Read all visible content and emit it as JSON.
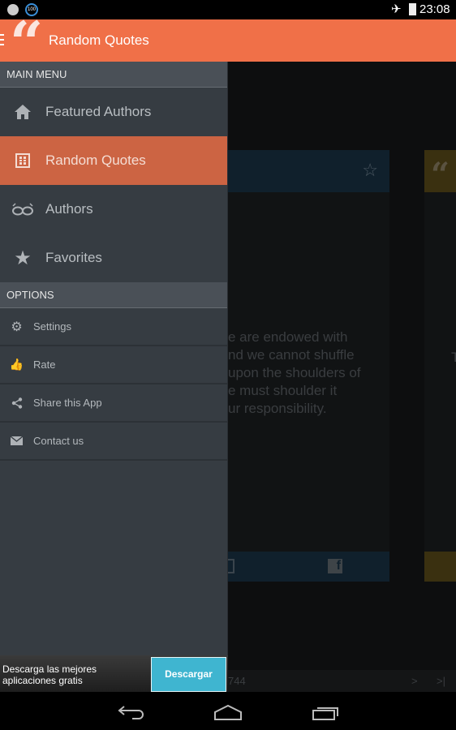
{
  "status": {
    "time": "23:08",
    "battery_badge": "100"
  },
  "appbar": {
    "title": "Random Quotes"
  },
  "drawer": {
    "main_header": "MAIN MENU",
    "main_items": [
      {
        "label": "Featured Authors",
        "icon": "home-icon"
      },
      {
        "label": "Random Quotes",
        "icon": "grid-icon",
        "selected": true
      },
      {
        "label": "Authors",
        "icon": "glasses-icon"
      },
      {
        "label": "Favorites",
        "icon": "star-icon"
      }
    ],
    "options_header": "OPTIONS",
    "options_items": [
      {
        "label": "Settings",
        "icon": "gear-icon"
      },
      {
        "label": "Rate",
        "icon": "thumbs-up-icon"
      },
      {
        "label": "Share this App",
        "icon": "share-icon"
      },
      {
        "label": "Contact us",
        "icon": "mail-icon"
      }
    ]
  },
  "background": {
    "quote_lines": [
      "e are endowed with",
      "nd we cannot shuffle",
      "upon the shoulders of",
      "e must shoulder it",
      "ur responsibility."
    ],
    "second_card_char": "T",
    "counter": "744",
    "next": ">",
    "last": ">|"
  },
  "ad": {
    "text_line1": "Descarga las mejores",
    "text_line2": "aplicaciones gratis",
    "button": "Descargar"
  },
  "colors": {
    "accent": "#f07048",
    "selected": "#cc6443",
    "drawer": "#363c42",
    "ad_button": "#3fb5d0"
  }
}
